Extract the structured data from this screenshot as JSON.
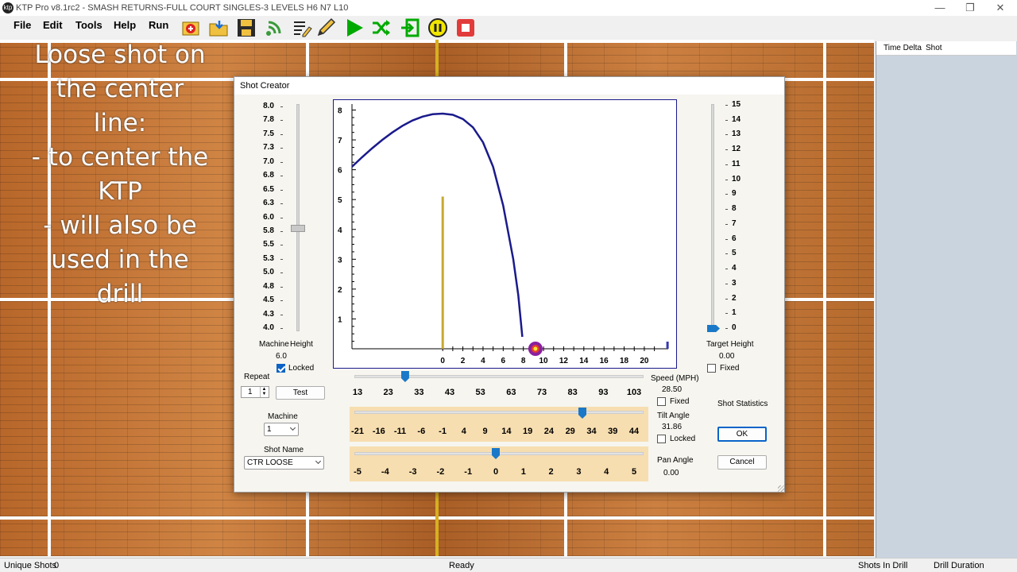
{
  "window": {
    "title": "KTP Pro v8.1rc2 - SMASH RETURNS-FULL COURT SINGLES-3 LEVELS H6 N7 L10",
    "icon": "app-logo",
    "app_icon_text": "ktp"
  },
  "menu": [
    "File",
    "Edit",
    "Tools",
    "Help",
    "Run"
  ],
  "toolbar": [
    "add-shot-icon",
    "open-folder-icon",
    "save-disk-icon",
    "signal-icon",
    "edit-list-icon",
    "pencil-icon",
    "play-icon",
    "shuffle-icon",
    "enter-icon",
    "pause-icon",
    "stop-icon"
  ],
  "overlay_text": [
    "Loose shot on",
    "the center",
    "line:",
    "- to center the",
    "KTP",
    "- will also be",
    "used in the",
    "drill"
  ],
  "right_panel": {
    "col1": "Time Delta",
    "col2": "Shot"
  },
  "status": {
    "unique_label": "Unique Shots",
    "unique_value": "0",
    "state": "Ready",
    "shots_in_drill": "Shots In Drill",
    "drill_duration": "Drill Duration"
  },
  "dialog": {
    "title": "Shot Creator",
    "machine_height": {
      "label1": "Machine",
      "label2": "Height",
      "value": "6.0",
      "locked_label": "Locked",
      "locked": true,
      "ticks": [
        "8.0",
        "7.8",
        "7.5",
        "7.3",
        "7.0",
        "6.8",
        "6.5",
        "6.3",
        "6.0",
        "5.8",
        "5.5",
        "5.3",
        "5.0",
        "4.8",
        "4.5",
        "4.3",
        "4.0"
      ],
      "level": 5.8
    },
    "target_height": {
      "label": "Target Height",
      "value": "0.00",
      "fixed_label": "Fixed",
      "fixed": false,
      "ticks": [
        "15",
        "14",
        "13",
        "12",
        "11",
        "10",
        "9",
        "8",
        "7",
        "6",
        "5",
        "4",
        "3",
        "2",
        "1",
        "0"
      ],
      "level": 0
    },
    "repeat": {
      "label": "Repeat",
      "value": "1",
      "test_label": "Test"
    },
    "machine": {
      "label": "Machine",
      "value": "1"
    },
    "shot_name": {
      "label": "Shot Name",
      "value": "CTR LOOSE"
    },
    "speed": {
      "label": "Speed (MPH)",
      "value": "28.50",
      "fixed_label": "Fixed",
      "fixed": false,
      "ticks": [
        "13",
        "23",
        "33",
        "43",
        "53",
        "63",
        "73",
        "83",
        "93",
        "103"
      ],
      "level": 28.5
    },
    "tilt": {
      "label": "Tilt Angle",
      "value": "31.86",
      "locked_label": "Locked",
      "locked": false,
      "ticks": [
        "-21",
        "-16",
        "-11",
        "-6",
        "-1",
        "4",
        "9",
        "14",
        "19",
        "24",
        "29",
        "34",
        "39",
        "44"
      ],
      "level": 31.86
    },
    "pan": {
      "label": "Pan Angle",
      "value": "0.00",
      "ticks": [
        "-5",
        "-4",
        "-3",
        "-2",
        "-1",
        "0",
        "1",
        "2",
        "3",
        "4",
        "5"
      ],
      "level": 0
    },
    "shot_statistics": "Shot Statistics",
    "ok_label": "OK",
    "cancel_label": "Cancel",
    "colors": {
      "trajectory": "#1a1a8c",
      "net": "#c8a830",
      "landing": "#8b1fa0",
      "slider": "#1a78c8",
      "band": "#f7deb0"
    }
  },
  "chart_data": {
    "type": "line",
    "title": "",
    "xlabel": "",
    "ylabel": "",
    "xlim": [
      -9,
      23
    ],
    "ylim": [
      0,
      8.2
    ],
    "x_ticks": [
      "0",
      "2",
      "4",
      "6",
      "8",
      "10",
      "12",
      "14",
      "16",
      "18",
      "20"
    ],
    "y_ticks": [
      "8",
      "7",
      "6",
      "5",
      "4",
      "3",
      "2",
      "1"
    ],
    "series": [
      {
        "name": "",
        "x": [
          -9,
          -8,
          -7,
          -6,
          -5,
          -4,
          -3,
          -2,
          -1,
          0,
          1,
          2,
          3,
          4,
          5,
          6,
          7,
          7.5,
          7.9
        ],
        "y": [
          6.1,
          6.42,
          6.72,
          7.0,
          7.25,
          7.47,
          7.65,
          7.78,
          7.86,
          7.88,
          7.84,
          7.7,
          7.42,
          6.92,
          6.1,
          4.8,
          3.0,
          1.8,
          0.4
        ]
      }
    ],
    "net": {
      "x": 0,
      "height": 5.1
    },
    "landing_x": 9.2,
    "end_marker_x": 22.3
  }
}
